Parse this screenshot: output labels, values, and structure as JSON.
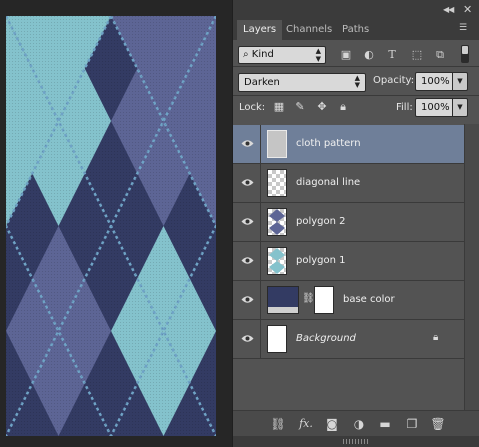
{
  "colors": {
    "navy": "#333b63",
    "slate_diamond": "#5d6595",
    "aqua_diamond": "#84c2cc",
    "stitch_line": "#6fa3c6",
    "panel_bg": "#535353",
    "selected_row": "#6f7f99"
  },
  "panel": {
    "tabs": [
      {
        "label": "Layers",
        "active": true
      },
      {
        "label": "Channels",
        "active": false
      },
      {
        "label": "Paths",
        "active": false
      }
    ],
    "collapse_icon": "double-chevron-icon",
    "close_icon": "close-icon",
    "menu_icon": "panel-menu-icon"
  },
  "filter": {
    "kind_label": "Kind",
    "icons": [
      "pixel-filter-icon",
      "adjustment-filter-icon",
      "type-filter-icon",
      "shape-filter-icon",
      "smart-object-filter-icon"
    ]
  },
  "blend": {
    "mode": "Darken",
    "opacity_label": "Opacity:",
    "opacity_value": "100%"
  },
  "lock": {
    "label": "Lock:",
    "icons": [
      "lock-transparent-icon",
      "lock-brush-icon",
      "lock-move-icon",
      "lock-all-icon"
    ],
    "fill_label": "Fill:",
    "fill_value": "100%"
  },
  "layers": [
    {
      "name": "cloth pattern",
      "selected": true,
      "thumb": "gray",
      "italic": false
    },
    {
      "name": "diagonal line",
      "selected": false,
      "thumb": "transparent",
      "italic": false
    },
    {
      "name": "polygon 2",
      "selected": false,
      "thumb": "polygon2",
      "italic": false
    },
    {
      "name": "polygon 1",
      "selected": false,
      "thumb": "polygon1",
      "italic": false
    },
    {
      "name": "base color",
      "selected": false,
      "thumb": "fill-mask",
      "italic": false
    },
    {
      "name": "Background",
      "selected": false,
      "thumb": "white",
      "italic": true,
      "locked": true
    }
  ],
  "bottom_icons": [
    "link-layers-icon",
    "fx-icon",
    "add-mask-icon",
    "adjustment-layer-icon",
    "new-group-icon",
    "new-layer-icon",
    "trash-icon"
  ],
  "bottom_fx_label": "fx."
}
